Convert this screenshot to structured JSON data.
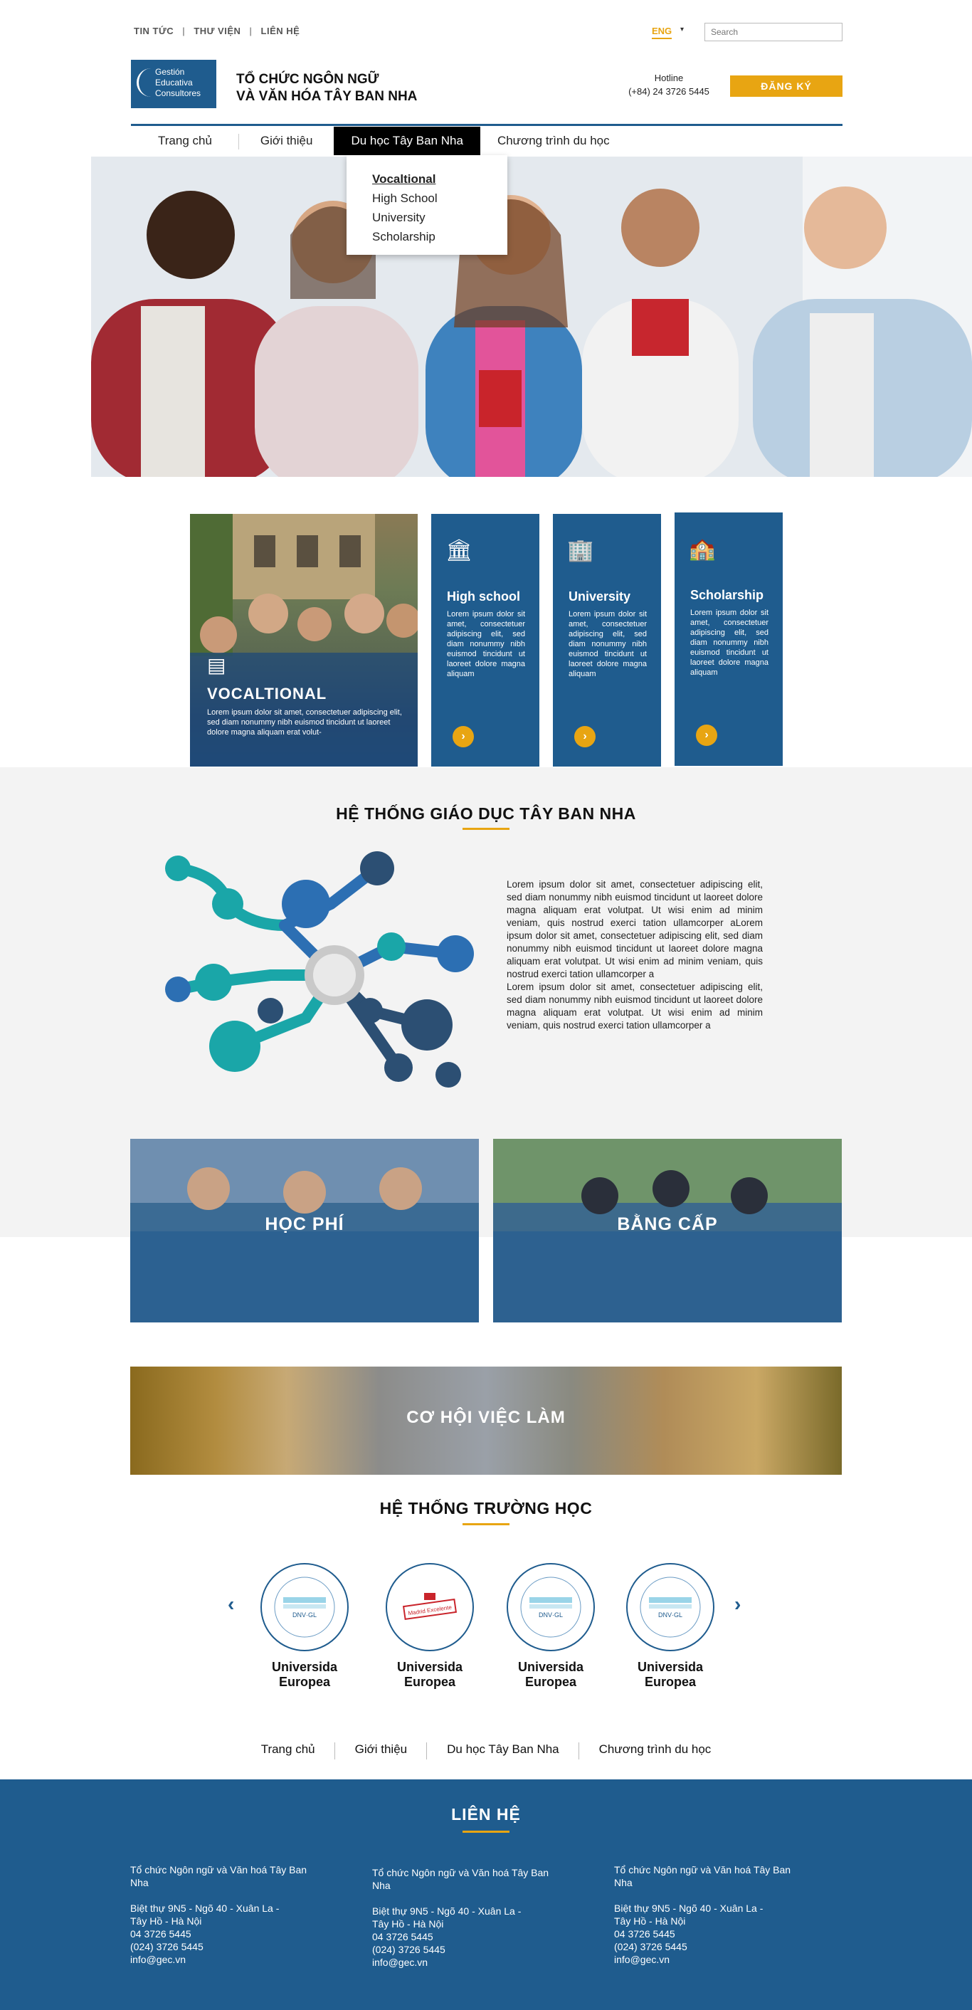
{
  "colors": {
    "primary": "#1f5c8e",
    "accent": "#e8a512",
    "light_bg": "#f3f3f3"
  },
  "topbar": {
    "links": [
      "TIN TỨC",
      "THƯ VIỆN",
      "LIÊN HỆ"
    ],
    "language": "ENG",
    "search_placeholder": "Search"
  },
  "header": {
    "logo_lines": [
      "Gestión",
      "Educativa",
      "Consultores"
    ],
    "org_name_line1": "TỔ CHỨC NGÔN NGỮ",
    "org_name_line2": "VÀ VĂN HÓA TÂY BAN NHA",
    "hotline_label": "Hotline",
    "hotline_number": "(+84) 24 3726 5445",
    "register_label": "ĐĂNG KÝ"
  },
  "nav": {
    "items": [
      "Trang chủ",
      "Giới thiệu",
      "Du học Tây Ban Nha",
      "Chương trình du học"
    ],
    "active_index": 2,
    "dropdown": [
      "Vocaltional",
      "High School",
      "University",
      "Scholarship"
    ]
  },
  "programs": {
    "featured": {
      "title": "VOCALTIONAL",
      "text": "Lorem ipsum dolor sit amet, consectetuer adipiscing elit, sed diam nonummy nibh euismod tincidunt ut laoreet dolore magna aliquam erat volut-",
      "icon": "certificate-icon"
    },
    "cards": [
      {
        "title": "High school",
        "text": "Lorem ipsum dolor sit amet, consectetuer adipiscing elit, sed diam nonummy nibh euismod tincidunt ut laoreet dolore magna aliquam",
        "icon": "school-building-icon"
      },
      {
        "title": "University",
        "text": "Lorem ipsum dolor sit amet, consectetuer adipiscing elit, sed diam nonummy nibh euismod tincidunt ut laoreet dolore magna aliquam",
        "icon": "university-building-icon"
      },
      {
        "title": "Scholarship",
        "text": "Lorem ipsum dolor sit amet, consectetuer adipiscing elit, sed diam nonummy nibh euismod tincidunt ut laoreet dolore magna aliquam",
        "icon": "campus-icon"
      }
    ],
    "card_button": "›"
  },
  "education_system": {
    "title": "HỆ THỐNG GIÁO DỤC TÂY BAN NHA",
    "paragraph1": "Lorem ipsum dolor sit amet, consectetuer adipiscing elit, sed diam nonummy nibh euismod tincidunt ut laoreet dolore magna aliquam erat volutpat. Ut wisi enim ad minim veniam, quis nostrud exerci tation ullamcorper aLorem ipsum dolor sit amet, consectetuer adipiscing elit, sed diam nonummy nibh euismod tincidunt ut laoreet dolore magna aliquam erat volutpat. Ut wisi enim ad minim veniam, quis nostrud exerci tation ullamcorper a",
    "paragraph2": "Lorem ipsum dolor sit amet, consectetuer adipiscing elit, sed diam nonummy nibh euismod tincidunt ut laoreet dolore magna aliquam erat volutpat. Ut wisi enim ad minim veniam, quis nostrud exerci tation ullamcorper a"
  },
  "tiles": [
    "HỌC PHÍ",
    "BẰNG CẤP"
  ],
  "career_label": "CƠ HỘI VIỆC LÀM",
  "schools": {
    "title": "HỆ THỐNG TRƯỜNG HỌC",
    "items": [
      {
        "name_line1": "Universida",
        "name_line2": "Europea",
        "badge": "DNV·GL"
      },
      {
        "name_line1": "Universida",
        "name_line2": "Europea",
        "badge": "Madrid Excelente"
      },
      {
        "name_line1": "Universida",
        "name_line2": "Europea",
        "badge": "DNV·GL"
      },
      {
        "name_line1": "Universida",
        "name_line2": "Europea",
        "badge": "DNV·GL"
      }
    ],
    "prev": "‹",
    "next": "›"
  },
  "footer_nav": [
    "Trang chủ",
    "Giới thiệu",
    "Du học Tây Ban Nha",
    "Chương trình du học"
  ],
  "footer": {
    "title": "LIÊN HỆ",
    "columns": [
      {
        "org": "Tổ chức Ngôn ngữ và Văn hoá Tây Ban Nha",
        "address1": "Biệt thự 9N5 - Ngõ 40 - Xuân La -",
        "address2": "Tây Hồ - Hà Nội",
        "phone1": "04 3726 5445",
        "phone2": "(024) 3726 5445",
        "email": "info@gec.vn"
      },
      {
        "org": "Tổ chức Ngôn ngữ và Văn hoá Tây Ban Nha",
        "address1": "Biệt thự 9N5 - Ngõ 40 - Xuân La -",
        "address2": "Tây Hồ - Hà Nội",
        "phone1": "04 3726 5445",
        "phone2": "(024) 3726 5445",
        "email": "info@gec.vn"
      },
      {
        "org": "Tổ chức Ngôn ngữ và Văn hoá Tây Ban Nha",
        "address1": "Biệt thự 9N5 - Ngõ 40 - Xuân La -",
        "address2": "Tây Hồ - Hà Nội",
        "phone1": "04 3726 5445",
        "phone2": "(024) 3726 5445",
        "email": "info@gec.vn"
      }
    ]
  }
}
